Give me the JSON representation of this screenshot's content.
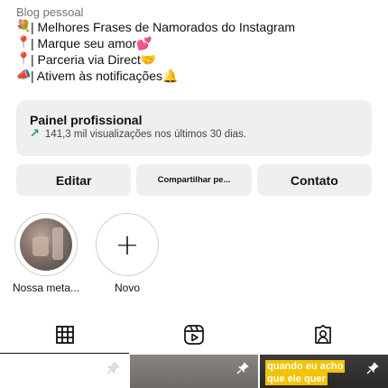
{
  "bio": {
    "category": "Blog pessoal",
    "lines": [
      {
        "emoji": "💐",
        "text": "| Melhores Frases de Namorados do Instagram"
      },
      {
        "emoji": "📍",
        "text": "| Marque seu amor💕"
      },
      {
        "emoji": "📍",
        "text": "| Parceria via Direct🤝"
      },
      {
        "emoji": "📣",
        "text": "| Ativem às notificações🔔"
      }
    ]
  },
  "professional_panel": {
    "title": "Painel profissional",
    "stats": "141,3 mil visualizações nos últimos 30 dias."
  },
  "actions": {
    "edit": "Editar",
    "share": "Compartilhar pe...",
    "contact": "Contato"
  },
  "highlights": [
    {
      "label": "Nossa meta..."
    },
    {
      "label": "Novo"
    }
  ],
  "tabs": [
    {
      "icon": "grid-icon",
      "active": true
    },
    {
      "icon": "reels-icon",
      "active": false
    },
    {
      "icon": "tagged-icon",
      "active": false
    }
  ],
  "posts": [
    {
      "pinned": true,
      "overlay": []
    },
    {
      "pinned": true,
      "overlay": []
    },
    {
      "pinned": true,
      "overlay": [
        "quando eu acho",
        "que ele quer"
      ]
    }
  ],
  "colors": {
    "button_bg": "#efefef",
    "stats_arrow": "#1aa260",
    "caption_highlight": "#f2c400"
  }
}
